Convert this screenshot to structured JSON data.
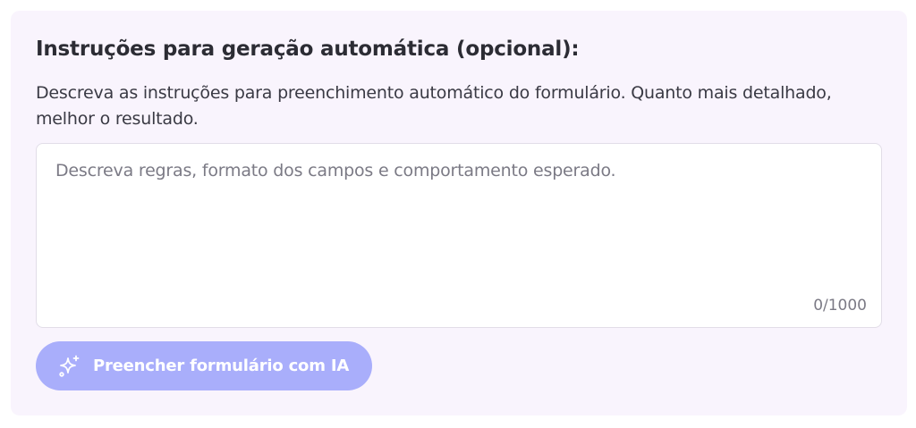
{
  "section": {
    "title": "Instruções para geração automática (opcional):",
    "description": "Descreva as instruções para preenchimento automático do formulário. Quanto mais detalhado, melhor o resultado."
  },
  "instructions_field": {
    "value": "",
    "placeholder": "Descreva regras, formato dos campos e comportamento esperado.",
    "counter": "0/1000"
  },
  "ai_button": {
    "label": "Preencher formulário com IA",
    "icon": "sparkles-icon",
    "state": "disabled"
  },
  "colors": {
    "card_background": "#f9f4fd",
    "button_background": "#a9aefb",
    "text_primary": "#2c2c34",
    "text_muted": "#7b7a85"
  }
}
